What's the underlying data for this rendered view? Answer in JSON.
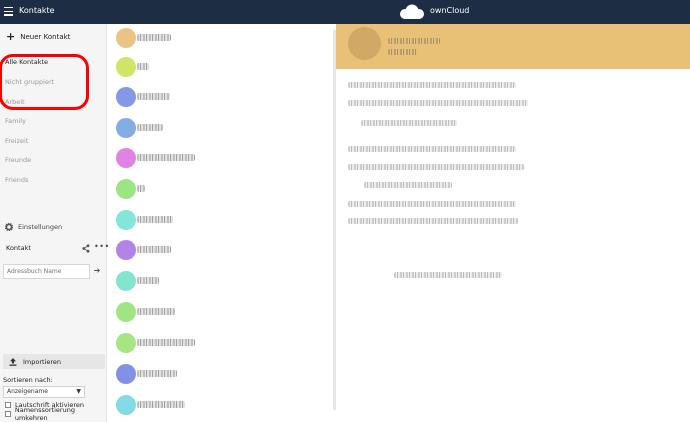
{
  "header": {
    "app_title": "Kontakte",
    "brand": "ownCloud",
    "menu_icon": "hamburger-menu-icon",
    "logo_icon": "owncloud-cloud-logo-icon",
    "bg_color": "#1d2d44"
  },
  "sidebar": {
    "new_contact_label": "Neuer Kontakt",
    "groups": [
      {
        "label": "Alle Kontakte",
        "active": true
      },
      {
        "label": "Nicht gruppiert",
        "active": false
      },
      {
        "label": "Arbeit",
        "active": false
      },
      {
        "label": "Family",
        "active": false
      },
      {
        "label": "Freizeit",
        "active": false
      },
      {
        "label": "Freunde",
        "active": false
      },
      {
        "label": "Friends",
        "active": false
      }
    ],
    "settings_label": "Einstellungen",
    "addressbook_label": "Kontakt",
    "addressbook_name_placeholder": "Adressbuch Name",
    "import_label": "Importieren",
    "sort_label": "Sortieren nach:",
    "sort_selected": "Anzeigename",
    "phonetic_label": "Lautschrift aktivieren",
    "reverse_sort_label": "Namenssortierung umkehren",
    "highlight_color": "#ff0000"
  },
  "contacts": {
    "avatar_colors": [
      "#e7b86f",
      "#c6e04c",
      "#6f86e0",
      "#6f9de0",
      "#d76fe0",
      "#8ae06f",
      "#6fe0d2",
      "#a56fe0",
      "#6fe0c6",
      "#8fe06f",
      "#96e06f",
      "#6f7de0",
      "#6fd4e0"
    ]
  },
  "details": {
    "header_color": "#e9c176"
  }
}
